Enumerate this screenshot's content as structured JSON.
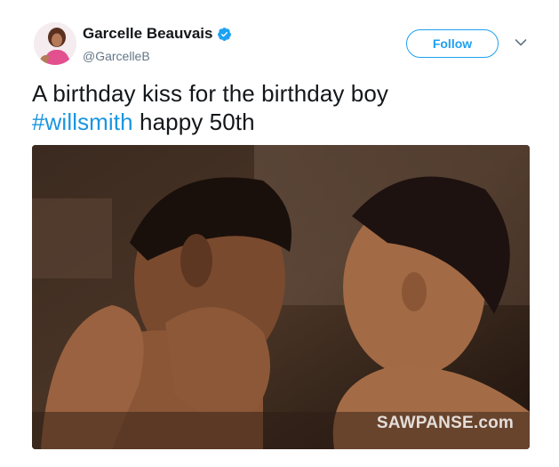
{
  "user": {
    "display_name": "Garcelle Beauvais",
    "handle": "@GarcelleB"
  },
  "follow_label": "Follow",
  "tweet": {
    "text": "A birthday kiss for the birthday boy",
    "hashtag": "#willsmith",
    "text_after_hashtag": " happy 50th"
  },
  "media": {
    "watermark": "SAWPANSE.com"
  },
  "icons": [
    "avatar",
    "verified-badge-icon",
    "chevron-down-icon"
  ],
  "colors": {
    "accent": "#1da1f2",
    "hashtag": "#1b95e0",
    "text": "#14171a",
    "muted": "#657786"
  }
}
